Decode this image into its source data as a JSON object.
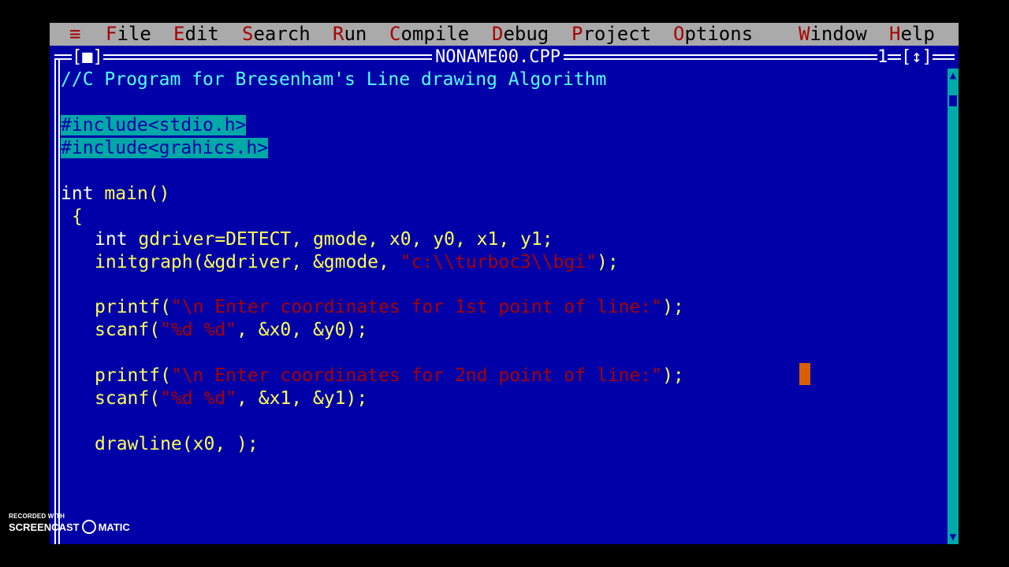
{
  "menu": {
    "system": "≡",
    "items": [
      {
        "hot": "F",
        "rest": "ile"
      },
      {
        "hot": "E",
        "rest": "dit"
      },
      {
        "hot": "S",
        "rest": "earch"
      },
      {
        "hot": "R",
        "rest": "un"
      },
      {
        "hot": "C",
        "rest": "ompile"
      },
      {
        "hot": "D",
        "rest": "ebug"
      },
      {
        "hot": "P",
        "rest": "roject"
      },
      {
        "hot": "O",
        "rest": "ptions"
      },
      {
        "hot": "W",
        "rest": "indow"
      },
      {
        "hot": "H",
        "rest": "elp"
      }
    ]
  },
  "window": {
    "close_box": "[■]",
    "title": "NONAME00.CPP",
    "number": "1",
    "zoom_box": "[↕]"
  },
  "code": {
    "l1": "//C Program for Bresenham's Line drawing Algorithm",
    "l3": "#include<stdio.h>",
    "l4": "#include<grahics.h>",
    "l6_kw": "int",
    "l6_id": "main()",
    "l7": "{",
    "l8_kw": "int",
    "l8_id": "gdriver=DETECT, gmode, x0, y0, x1, y1;",
    "l9_a": "initgraph(&gdriver, &gmode, ",
    "l9_str": "\"c:\\\\turboc3\\\\bgi\"",
    "l9_b": ");",
    "l11_a": "printf(",
    "l11_str": "\"\\n Enter coordinates for 1st point of line:\"",
    "l11_b": ");",
    "l12_a": "scanf(",
    "l12_str": "\"%d %d\"",
    "l12_b": ", &x0, &y0);",
    "l14_a": "printf(",
    "l14_str": "\"\\n Enter coordinates for 2nd point of line:\"",
    "l14_b": ");",
    "l15_a": "scanf(",
    "l15_str": "\"%d %d\"",
    "l15_b": ", &x1, &y1);",
    "l17": "drawline(x0, );"
  },
  "scrollbar": {
    "up": "▲",
    "down": "▼"
  },
  "watermark": {
    "top": "RECORDED WITH",
    "left": "SCREENCAST",
    "right": "MATIC"
  },
  "colors": {
    "editor_bg": "#0000a8",
    "menu_bg": "#aaaaaa",
    "hotkey": "#a80000",
    "comment": "#55ffff",
    "keyword": "#ffffff",
    "identifier": "#ffff55",
    "string": "#a80000",
    "selection": "#00a8a8"
  }
}
